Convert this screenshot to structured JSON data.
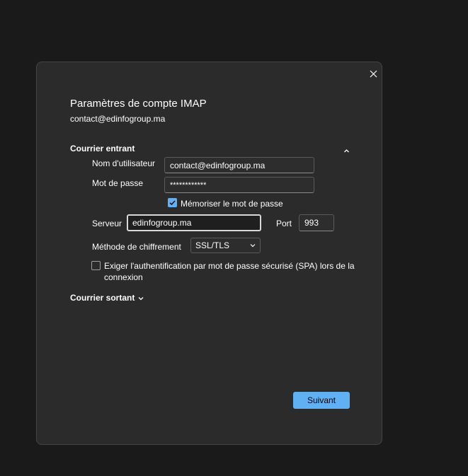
{
  "dialog": {
    "title": "Paramètres de compte IMAP",
    "account_email": "contact@edinfogroup.ma",
    "close_icon": "close-icon"
  },
  "incoming": {
    "heading": "Courrier entrant",
    "collapse_icon": "chevron-up-icon",
    "username_label": "Nom d'utilisateur",
    "username_value": "contact@edinfogroup.ma",
    "password_label": "Mot de passe",
    "password_value": "************",
    "remember_password_label": "Mémoriser le mot de passe",
    "remember_password_checked": true,
    "server_label": "Serveur",
    "server_value": "edinfogroup.ma",
    "port_label": "Port",
    "port_value": "993",
    "encryption_label": "Méthode de chiffrement",
    "encryption_value": "SSL/TLS",
    "spa_label": "Exiger l'authentification par mot de passe sécurisé (SPA) lors de la",
    "spa_label_cont": "connexion",
    "spa_checked": false
  },
  "outgoing": {
    "heading": "Courrier sortant",
    "expand_icon": "chevron-down-icon"
  },
  "footer": {
    "next_label": "Suivant"
  },
  "colors": {
    "background": "#1a1a1a",
    "dialog": "#2b2b2b",
    "accent": "#60b0f4"
  }
}
